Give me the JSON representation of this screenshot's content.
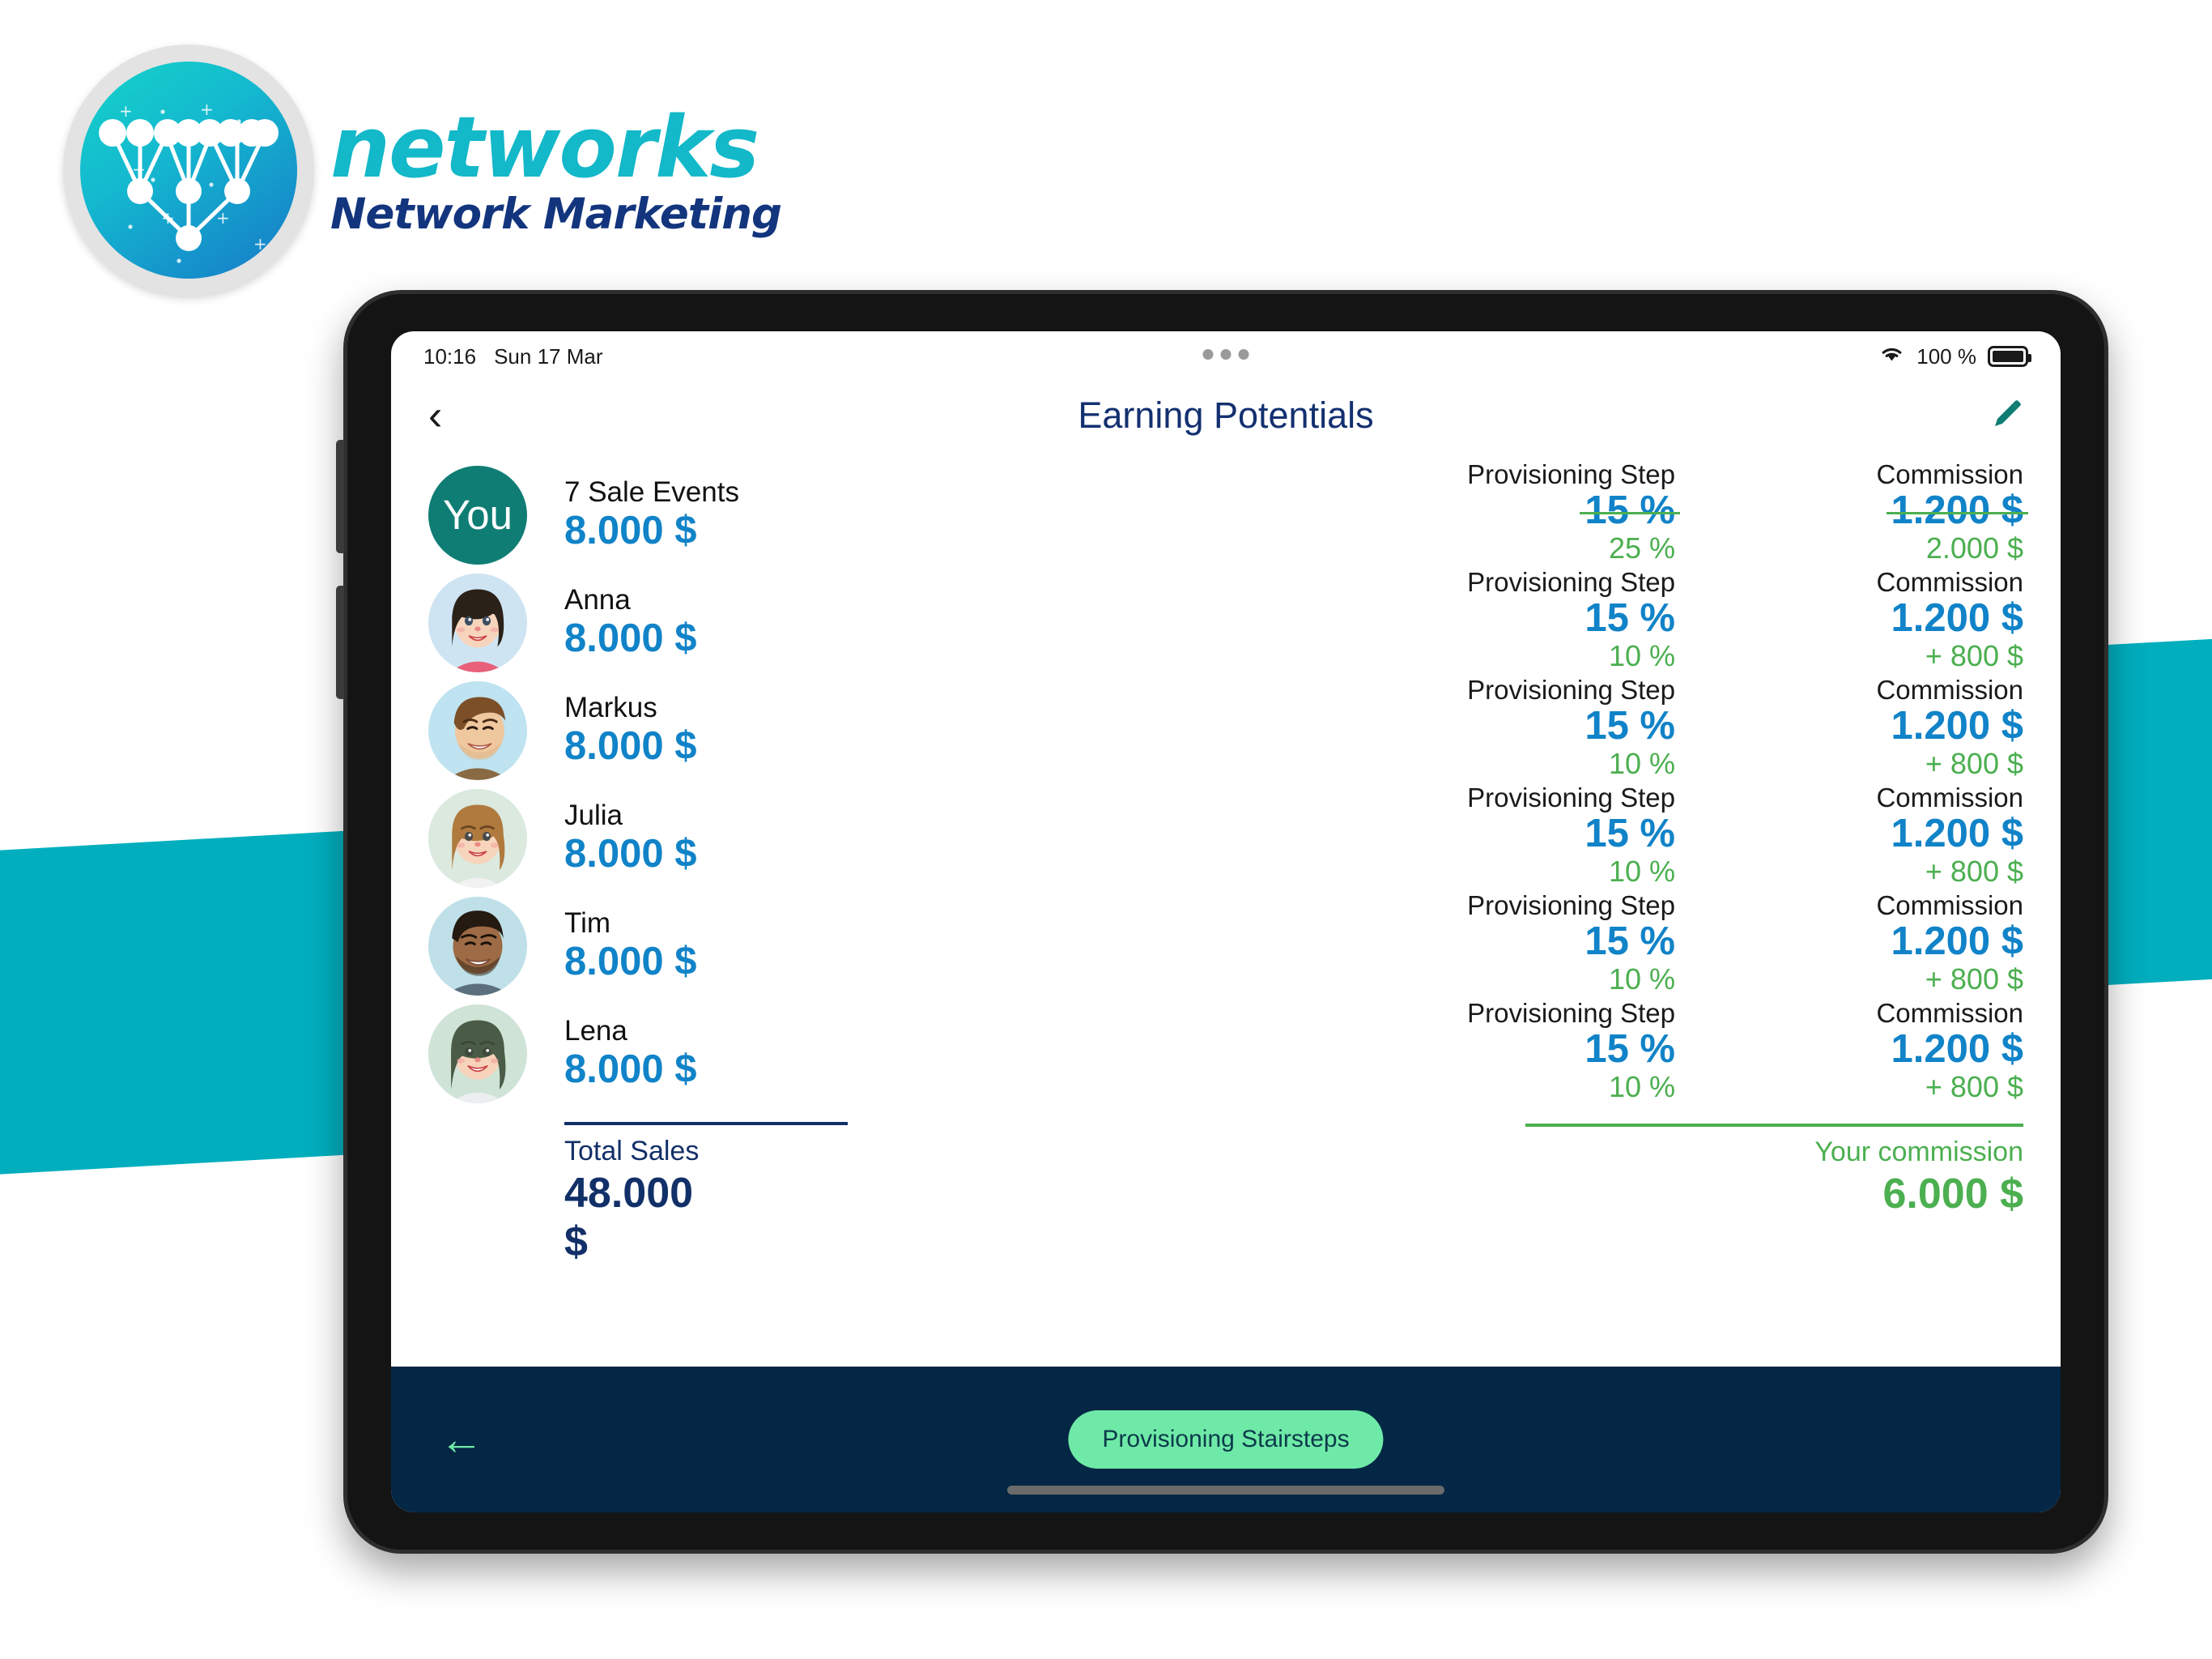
{
  "brand": {
    "title": "networks",
    "subtitle": "Network Marketing",
    "logo_icon": "network-tree-icon",
    "teal": "#00AEBE",
    "navy": "#12357E"
  },
  "statusbar": {
    "time": "10:16",
    "date": "Sun 17 Mar",
    "wifi_icon": "wifi-icon",
    "battery_percent": "100 %",
    "battery_icon": "battery-full-icon",
    "camera_dots": [
      "dot",
      "dot",
      "dot"
    ]
  },
  "header": {
    "back_icon": "chevron-left-icon",
    "title": "Earning Potentials",
    "edit_icon": "pencil-icon",
    "title_color": "#133070",
    "edit_color": "#0F7D74"
  },
  "members": [
    {
      "avatar_label": "You",
      "avatar_type": "initials",
      "name": "7 Sale Events",
      "amount": "8.000 $"
    },
    {
      "avatar_label": "",
      "avatar_type": "photo-anna",
      "name": "Anna",
      "amount": "8.000 $"
    },
    {
      "avatar_label": "",
      "avatar_type": "photo-markus",
      "name": "Markus",
      "amount": "8.000 $"
    },
    {
      "avatar_label": "",
      "avatar_type": "photo-julia",
      "name": "Julia",
      "amount": "8.000 $"
    },
    {
      "avatar_label": "",
      "avatar_type": "photo-tim",
      "name": "Tim",
      "amount": "8.000 $"
    },
    {
      "avatar_label": "",
      "avatar_type": "photo-lena",
      "name": "Lena",
      "amount": "8.000 $"
    }
  ],
  "totals": {
    "sales_label": "Total Sales",
    "sales_amount": "48.000 $"
  },
  "steps": [
    {
      "step_label": "Provisioning Step",
      "step_value": "15 %",
      "step_value_struck": true,
      "step_bonus": "25 %",
      "comm_label": "Commission",
      "comm_value": "1.200 $",
      "comm_value_struck": true,
      "comm_bonus": "2.000 $"
    },
    {
      "step_label": "Provisioning Step",
      "step_value": "15 %",
      "step_value_struck": false,
      "step_bonus": "10 %",
      "comm_label": "Commission",
      "comm_value": "1.200 $",
      "comm_value_struck": false,
      "comm_bonus": "+ 800 $"
    },
    {
      "step_label": "Provisioning Step",
      "step_value": "15 %",
      "step_value_struck": false,
      "step_bonus": "10 %",
      "comm_label": "Commission",
      "comm_value": "1.200 $",
      "comm_value_struck": false,
      "comm_bonus": "+ 800 $"
    },
    {
      "step_label": "Provisioning Step",
      "step_value": "15 %",
      "step_value_struck": false,
      "step_bonus": "10 %",
      "comm_label": "Commission",
      "comm_value": "1.200 $",
      "comm_value_struck": false,
      "comm_bonus": "+ 800 $"
    },
    {
      "step_label": "Provisioning Step",
      "step_value": "15 %",
      "step_value_struck": false,
      "step_bonus": "10 %",
      "comm_label": "Commission",
      "comm_value": "1.200 $",
      "comm_value_struck": false,
      "comm_bonus": "+ 800 $"
    },
    {
      "step_label": "Provisioning Step",
      "step_value": "15 %",
      "step_value_struck": false,
      "step_bonus": "10 %",
      "comm_label": "Commission",
      "comm_value": "1.200 $",
      "comm_value_struck": false,
      "comm_bonus": "+ 800 $"
    }
  ],
  "commission": {
    "label": "Your commission",
    "amount": "6.000 $",
    "color": "#4CAF50"
  },
  "bottombar": {
    "back_icon": "arrow-left-icon",
    "button_label": "Provisioning Stairsteps",
    "bg": "#032744",
    "accent": "#6FE9A7"
  },
  "palette": {
    "blue_value": "#1183C8",
    "green": "#4CAF50",
    "navy": "#123068",
    "teal_avatar": "#0F7D74"
  }
}
